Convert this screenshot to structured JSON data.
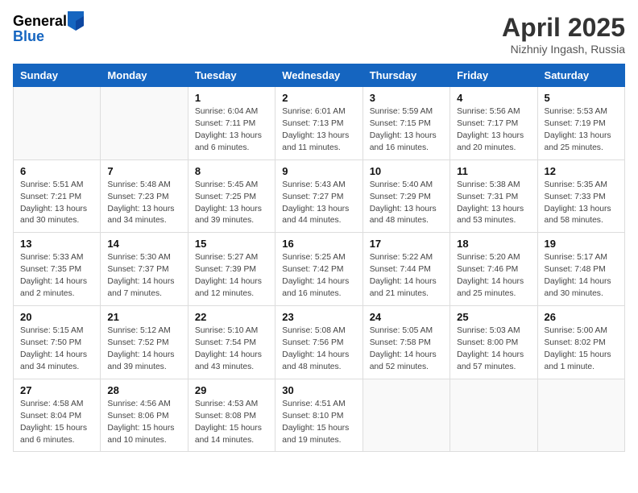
{
  "header": {
    "logo_general": "General",
    "logo_blue": "Blue",
    "month_title": "April 2025",
    "location": "Nizhniy Ingash, Russia"
  },
  "weekdays": [
    "Sunday",
    "Monday",
    "Tuesday",
    "Wednesday",
    "Thursday",
    "Friday",
    "Saturday"
  ],
  "weeks": [
    [
      {
        "day": "",
        "info": ""
      },
      {
        "day": "",
        "info": ""
      },
      {
        "day": "1",
        "info": "Sunrise: 6:04 AM\nSunset: 7:11 PM\nDaylight: 13 hours and 6 minutes."
      },
      {
        "day": "2",
        "info": "Sunrise: 6:01 AM\nSunset: 7:13 PM\nDaylight: 13 hours and 11 minutes."
      },
      {
        "day": "3",
        "info": "Sunrise: 5:59 AM\nSunset: 7:15 PM\nDaylight: 13 hours and 16 minutes."
      },
      {
        "day": "4",
        "info": "Sunrise: 5:56 AM\nSunset: 7:17 PM\nDaylight: 13 hours and 20 minutes."
      },
      {
        "day": "5",
        "info": "Sunrise: 5:53 AM\nSunset: 7:19 PM\nDaylight: 13 hours and 25 minutes."
      }
    ],
    [
      {
        "day": "6",
        "info": "Sunrise: 5:51 AM\nSunset: 7:21 PM\nDaylight: 13 hours and 30 minutes."
      },
      {
        "day": "7",
        "info": "Sunrise: 5:48 AM\nSunset: 7:23 PM\nDaylight: 13 hours and 34 minutes."
      },
      {
        "day": "8",
        "info": "Sunrise: 5:45 AM\nSunset: 7:25 PM\nDaylight: 13 hours and 39 minutes."
      },
      {
        "day": "9",
        "info": "Sunrise: 5:43 AM\nSunset: 7:27 PM\nDaylight: 13 hours and 44 minutes."
      },
      {
        "day": "10",
        "info": "Sunrise: 5:40 AM\nSunset: 7:29 PM\nDaylight: 13 hours and 48 minutes."
      },
      {
        "day": "11",
        "info": "Sunrise: 5:38 AM\nSunset: 7:31 PM\nDaylight: 13 hours and 53 minutes."
      },
      {
        "day": "12",
        "info": "Sunrise: 5:35 AM\nSunset: 7:33 PM\nDaylight: 13 hours and 58 minutes."
      }
    ],
    [
      {
        "day": "13",
        "info": "Sunrise: 5:33 AM\nSunset: 7:35 PM\nDaylight: 14 hours and 2 minutes."
      },
      {
        "day": "14",
        "info": "Sunrise: 5:30 AM\nSunset: 7:37 PM\nDaylight: 14 hours and 7 minutes."
      },
      {
        "day": "15",
        "info": "Sunrise: 5:27 AM\nSunset: 7:39 PM\nDaylight: 14 hours and 12 minutes."
      },
      {
        "day": "16",
        "info": "Sunrise: 5:25 AM\nSunset: 7:42 PM\nDaylight: 14 hours and 16 minutes."
      },
      {
        "day": "17",
        "info": "Sunrise: 5:22 AM\nSunset: 7:44 PM\nDaylight: 14 hours and 21 minutes."
      },
      {
        "day": "18",
        "info": "Sunrise: 5:20 AM\nSunset: 7:46 PM\nDaylight: 14 hours and 25 minutes."
      },
      {
        "day": "19",
        "info": "Sunrise: 5:17 AM\nSunset: 7:48 PM\nDaylight: 14 hours and 30 minutes."
      }
    ],
    [
      {
        "day": "20",
        "info": "Sunrise: 5:15 AM\nSunset: 7:50 PM\nDaylight: 14 hours and 34 minutes."
      },
      {
        "day": "21",
        "info": "Sunrise: 5:12 AM\nSunset: 7:52 PM\nDaylight: 14 hours and 39 minutes."
      },
      {
        "day": "22",
        "info": "Sunrise: 5:10 AM\nSunset: 7:54 PM\nDaylight: 14 hours and 43 minutes."
      },
      {
        "day": "23",
        "info": "Sunrise: 5:08 AM\nSunset: 7:56 PM\nDaylight: 14 hours and 48 minutes."
      },
      {
        "day": "24",
        "info": "Sunrise: 5:05 AM\nSunset: 7:58 PM\nDaylight: 14 hours and 52 minutes."
      },
      {
        "day": "25",
        "info": "Sunrise: 5:03 AM\nSunset: 8:00 PM\nDaylight: 14 hours and 57 minutes."
      },
      {
        "day": "26",
        "info": "Sunrise: 5:00 AM\nSunset: 8:02 PM\nDaylight: 15 hours and 1 minute."
      }
    ],
    [
      {
        "day": "27",
        "info": "Sunrise: 4:58 AM\nSunset: 8:04 PM\nDaylight: 15 hours and 6 minutes."
      },
      {
        "day": "28",
        "info": "Sunrise: 4:56 AM\nSunset: 8:06 PM\nDaylight: 15 hours and 10 minutes."
      },
      {
        "day": "29",
        "info": "Sunrise: 4:53 AM\nSunset: 8:08 PM\nDaylight: 15 hours and 14 minutes."
      },
      {
        "day": "30",
        "info": "Sunrise: 4:51 AM\nSunset: 8:10 PM\nDaylight: 15 hours and 19 minutes."
      },
      {
        "day": "",
        "info": ""
      },
      {
        "day": "",
        "info": ""
      },
      {
        "day": "",
        "info": ""
      }
    ]
  ]
}
